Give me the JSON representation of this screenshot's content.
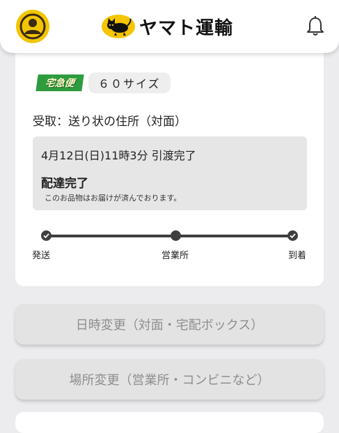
{
  "header": {
    "brand_name": "ヤマト運輸",
    "avatar_icon": "user-avatar-icon",
    "bell_icon": "bell-icon",
    "accent_color": "#f2c500"
  },
  "shipment": {
    "service_badge": "宅急便",
    "size": "６０サイズ",
    "receive_method": "受取：送り状の住所（対面）",
    "status": {
      "datetime": "4月12日(日)11時3分 引渡完了",
      "title": "配達完了",
      "note": "このお品物はお届けが済んでおります。"
    },
    "progress": {
      "steps": [
        "発送",
        "営業所",
        "到着"
      ]
    }
  },
  "actions": {
    "change_date": "日時変更（対面・宅配ボックス）",
    "change_place": "場所変更（営業所・コンビニなど）"
  }
}
